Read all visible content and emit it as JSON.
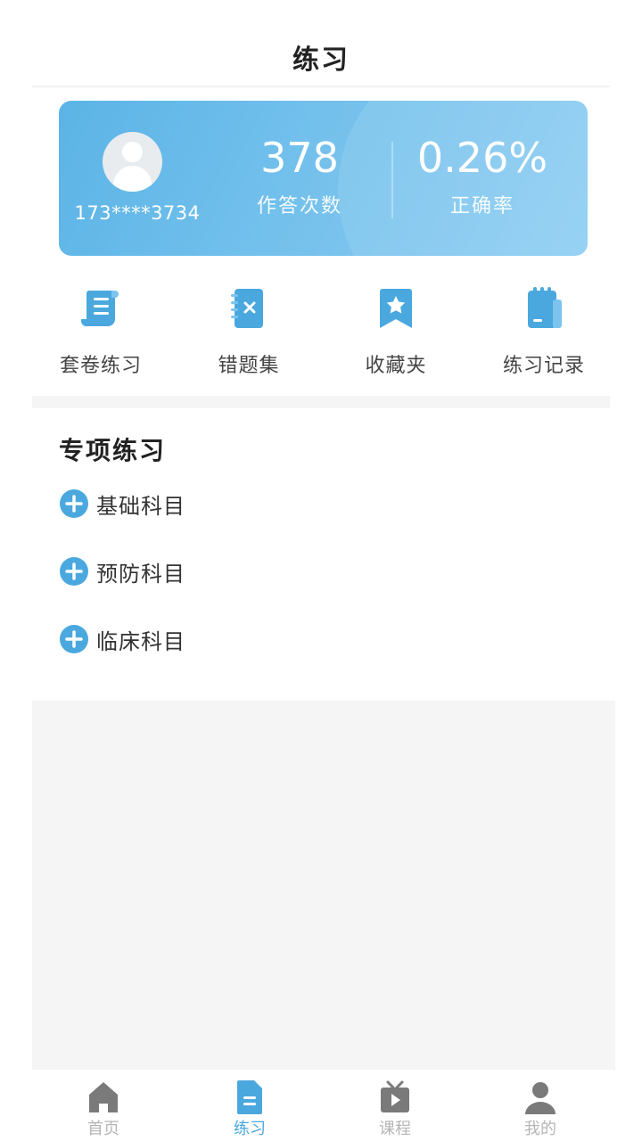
{
  "header": {
    "title": "练习"
  },
  "profile": {
    "username": "173****3734"
  },
  "stats": {
    "answer_count": {
      "value": "378",
      "label": "作答次数"
    },
    "accuracy": {
      "value": "0.26%",
      "label": "正确率"
    }
  },
  "quick_actions": [
    {
      "label": "套卷练习",
      "icon": "scroll-icon"
    },
    {
      "label": "错题集",
      "icon": "wrong-notebook-icon"
    },
    {
      "label": "收藏夹",
      "icon": "bookmark-star-icon"
    },
    {
      "label": "练习记录",
      "icon": "clipboard-icon"
    }
  ],
  "special_practice": {
    "title": "专项练习",
    "items": [
      {
        "label": "基础科目",
        "icon": "plus-circle-icon"
      },
      {
        "label": "预防科目",
        "icon": "plus-circle-icon"
      },
      {
        "label": "临床科目",
        "icon": "plus-circle-icon"
      }
    ]
  },
  "tabbar": {
    "active_index": 1,
    "tabs": [
      {
        "label": "首页",
        "icon": "home-icon"
      },
      {
        "label": "练习",
        "icon": "document-icon"
      },
      {
        "label": "课程",
        "icon": "video-play-icon"
      },
      {
        "label": "我的",
        "icon": "user-icon"
      }
    ]
  },
  "colors": {
    "accent": "#4aa8de",
    "card_start": "#5bb4e6",
    "card_end": "#8ccdf2",
    "icon_blue": "#4aa8de"
  }
}
